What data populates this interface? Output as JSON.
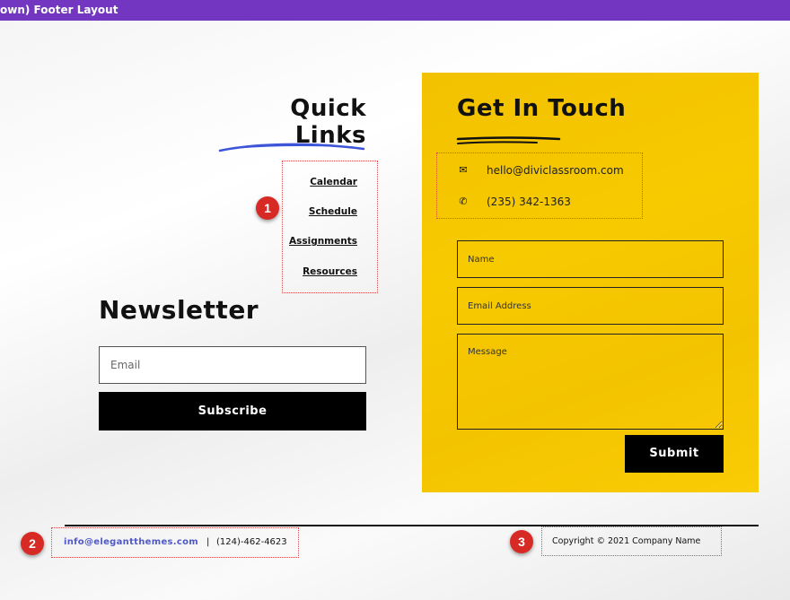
{
  "window": {
    "title": "own) Footer Layout"
  },
  "quick_links": {
    "title": "Quick Links",
    "links": [
      "Calendar",
      "Schedule",
      "Assignments",
      "Resources"
    ]
  },
  "newsletter": {
    "title": "Newsletter",
    "email_placeholder": "Email",
    "button_label": "Subscribe"
  },
  "get_in_touch": {
    "title": "Get In Touch",
    "email": "hello@diviclassroom.com",
    "phone": "(235) 342-1363",
    "email_icon": "envelope-icon",
    "phone_icon": "phone-icon",
    "form": {
      "name_placeholder": "Name",
      "email_placeholder": "Email Address",
      "message_placeholder": "Message",
      "submit_label": "Submit"
    }
  },
  "footer": {
    "email": "info@elegantthemes.com",
    "separator": "|",
    "phone": "(124)-462-4623",
    "copyright": "Copyright © 2021 Company Name"
  },
  "badges": [
    "1",
    "2",
    "3"
  ],
  "colors": {
    "topbar": "#7236c1",
    "panel": "#f7ca00",
    "badge": "#d82a24",
    "link_accent": "#4f59c9",
    "underline_blue": "#3d55d8"
  }
}
